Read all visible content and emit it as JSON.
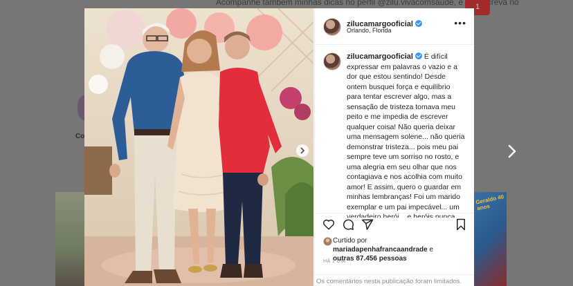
{
  "background": {
    "top_text": "Acompanhe também minhas dicas no perfil @zilu.vivacomsaude, e se inscreva no",
    "badge": "1",
    "story_label": "Co",
    "thumb_text": "Geraldo 40 anos"
  },
  "post": {
    "username": "zilucamargooficial",
    "location": "Orlando, Florida",
    "caption_user": "zilucamargooficial",
    "caption_text": "É difícil expressar em palavras o vazio e a dor que estou sentindo! Desde ontem busquei força e equilíbrio para tentar escrever algo, mas a sensação de tristeza tomava meu peito e me impedia de escrever qualquer coisa! Não queria deixar uma mensagem solene... não queria demonstrar tristeza... pois meu pai sempre teve um sorriso no rosto, e uma alegria em seu olhar que nos contagiava e nos acolhia com muito amor! E assim, quero o guardar em minhas lembranças! Foi um marido exemplar e um pai impecável... um verdadeiro herói... e heróis nunca morrem... tanto que, partiu às",
    "liked_prefix": "Curtido por",
    "liked_user": "mariadapenhafrancaandrade",
    "liked_conj": "e",
    "liked_others": "outras 87.456 pessoas",
    "time": "HÁ 1 DIA",
    "comments_limited": "Os comentários nesta publicação foram limitados."
  },
  "icons": [
    "verified-icon",
    "more-icon",
    "heart-icon",
    "comment-icon",
    "share-icon",
    "bookmark-icon",
    "chevron-right-icon"
  ],
  "colors": {
    "accent": "#3897f0",
    "text": "#262626",
    "muted": "#8e8e8e"
  }
}
